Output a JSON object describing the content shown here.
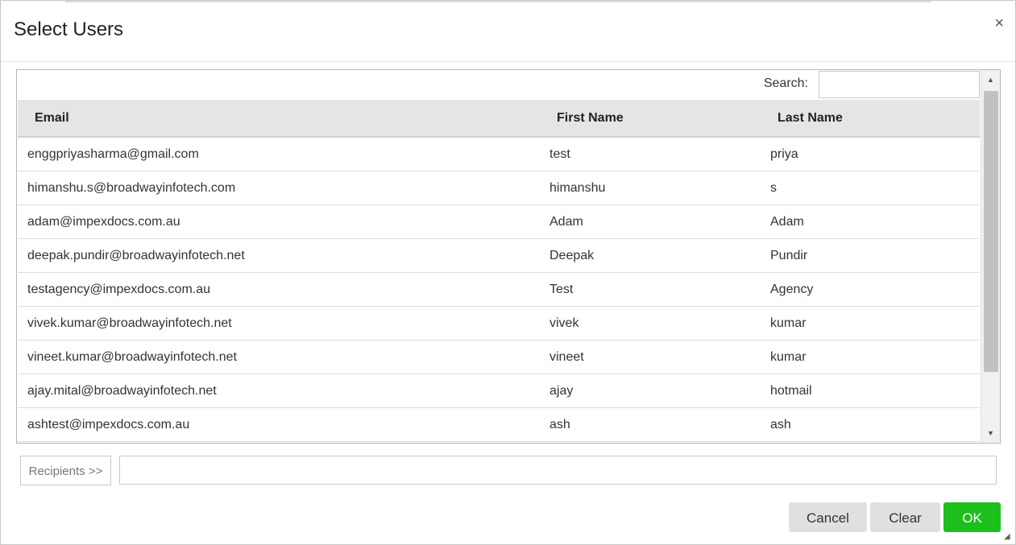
{
  "dialog": {
    "title": "Select Users",
    "close_glyph": "×"
  },
  "search": {
    "label": "Search:",
    "value": ""
  },
  "table": {
    "headers": {
      "email": "Email",
      "first_name": "First Name",
      "last_name": "Last Name"
    },
    "rows": [
      {
        "email": "enggpriyasharma@gmail.com",
        "first_name": "test",
        "last_name": "priya"
      },
      {
        "email": "himanshu.s@broadwayinfotech.com",
        "first_name": "himanshu",
        "last_name": "s"
      },
      {
        "email": "adam@impexdocs.com.au",
        "first_name": "Adam",
        "last_name": "Adam"
      },
      {
        "email": "deepak.pundir@broadwayinfotech.net",
        "first_name": "Deepak",
        "last_name": "Pundir"
      },
      {
        "email": "testagency@impexdocs.com.au",
        "first_name": "Test",
        "last_name": "Agency"
      },
      {
        "email": "vivek.kumar@broadwayinfotech.net",
        "first_name": "vivek",
        "last_name": "kumar"
      },
      {
        "email": "vineet.kumar@broadwayinfotech.net",
        "first_name": "vineet",
        "last_name": "kumar"
      },
      {
        "email": "ajay.mital@broadwayinfotech.net",
        "first_name": "ajay",
        "last_name": "hotmail"
      },
      {
        "email": "ashtest@impexdocs.com.au",
        "first_name": "ash",
        "last_name": "ash"
      }
    ]
  },
  "scrollbar": {
    "up_glyph": "▲",
    "down_glyph": "▼"
  },
  "recipients": {
    "button_label": "Recipients >>",
    "value": ""
  },
  "footer": {
    "cancel_label": "Cancel",
    "clear_label": "Clear",
    "ok_label": "OK",
    "ok_color": "#1dbf1d"
  },
  "resize_glyph": "◢"
}
